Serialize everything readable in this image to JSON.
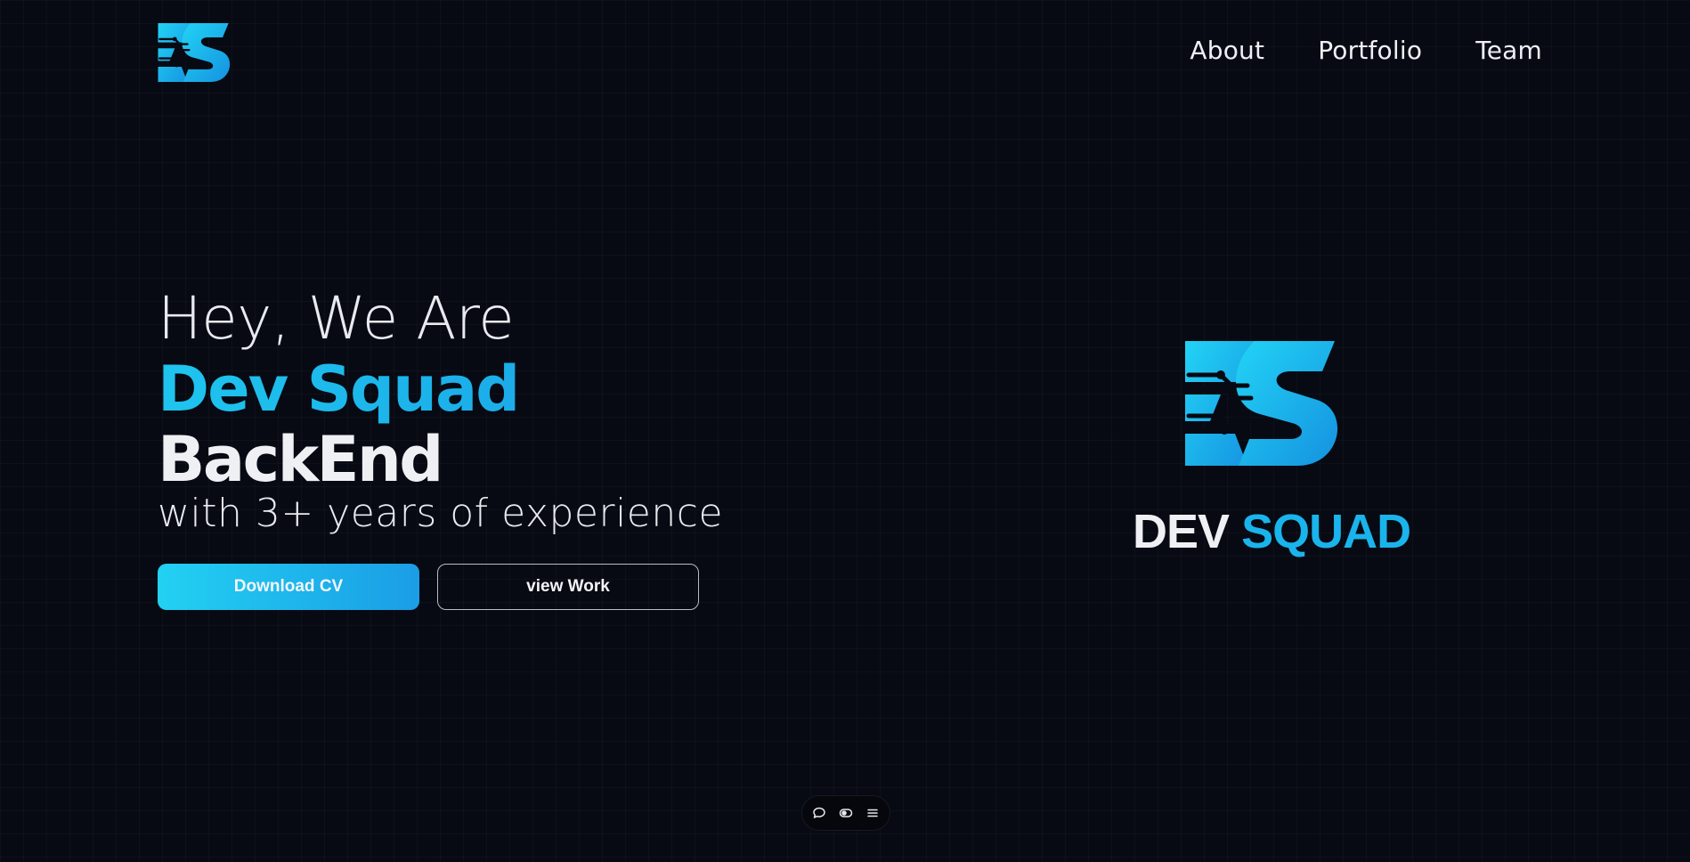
{
  "brand": {
    "logo_icon": "ds-circuit-logo",
    "name_first": "DEV",
    "name_second": "SQUAD"
  },
  "nav": {
    "items": [
      {
        "label": "About"
      },
      {
        "label": "Portfolio"
      },
      {
        "label": "Team"
      }
    ]
  },
  "hero": {
    "greeting": "Hey, We Are",
    "name": "Dev Squad",
    "role": "BackEnd",
    "subtitle": "with 3+ years of experience"
  },
  "buttons": {
    "primary_label": "Download CV",
    "secondary_label": "view Work"
  },
  "dock": {
    "items": [
      {
        "icon": "chat-bubble-icon"
      },
      {
        "icon": "toggle-theme-icon"
      },
      {
        "icon": "menu-icon"
      }
    ]
  },
  "colors": {
    "background": "#070a13",
    "accent_start": "#22d1f2",
    "accent_end": "#1b9de6",
    "text": "#eef0f4"
  }
}
